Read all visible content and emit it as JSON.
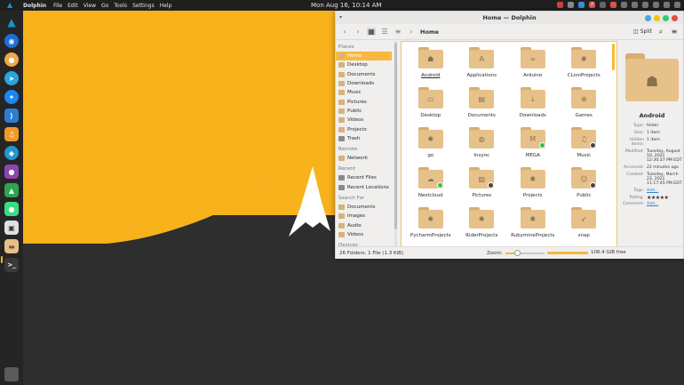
{
  "topbar": {
    "app_name": "Dolphin",
    "menu": [
      "File",
      "Edit",
      "View",
      "Go",
      "Tools",
      "Settings",
      "Help"
    ],
    "clock": "Mon Aug 16, 10:14 AM",
    "tray_badge": "2"
  },
  "dock": {
    "items": [
      "arch-logo",
      "browser-beta-icon",
      "contacts-icon",
      "telegram-icon",
      "messenger-icon",
      "vscode-icon",
      "office-icon",
      "flutter-icon",
      "github-icon",
      "charts-icon",
      "android-studio-icon",
      "store-icon",
      "files-icon",
      "terminal-icon"
    ]
  },
  "window": {
    "title": "Home — Dolphin",
    "breadcrumb": "Home",
    "split_label": "Split"
  },
  "sidebar": {
    "places_head": "Places",
    "places": [
      "Home",
      "Desktop",
      "Documents",
      "Downloads",
      "Music",
      "Pictures",
      "Public",
      "Videos",
      "Projects",
      "Trash"
    ],
    "remote_head": "Remote",
    "remote": [
      "Network"
    ],
    "recent_head": "Recent",
    "recent": [
      "Recent Files",
      "Recent Locations"
    ],
    "search_head": "Search For",
    "search": [
      "Documents",
      "Images",
      "Audio",
      "Videos"
    ],
    "devices_head": "Devices"
  },
  "files": [
    {
      "name": "Android",
      "emblem": "android-icon"
    },
    {
      "name": "Applications",
      "emblem": "applications-icon"
    },
    {
      "name": "Arduino",
      "emblem": "arduino-icon"
    },
    {
      "name": "CLionProjects",
      "emblem": "gear-icon"
    },
    {
      "name": "Desktop",
      "emblem": "desktop-icon"
    },
    {
      "name": "Documents",
      "emblem": "document-icon"
    },
    {
      "name": "Downloads",
      "emblem": "download-icon"
    },
    {
      "name": "Games",
      "emblem": "gamepad-icon"
    },
    {
      "name": "go",
      "emblem": "gear-icon"
    },
    {
      "name": "Insync",
      "emblem": "globe-icon"
    },
    {
      "name": "MEGA",
      "emblem": "mega-icon",
      "badge": "#3fb950"
    },
    {
      "name": "Music",
      "emblem": "music-icon",
      "badge": "#444444"
    },
    {
      "name": "Nextcloud",
      "emblem": "cloud-icon",
      "badge": "#3fb950"
    },
    {
      "name": "Pictures",
      "emblem": "image-icon",
      "badge": "#444444"
    },
    {
      "name": "Projects",
      "emblem": "gear-icon"
    },
    {
      "name": "Public",
      "emblem": "user-icon",
      "badge": "#444444"
    },
    {
      "name": "PycharmProjects",
      "emblem": "gear-icon"
    },
    {
      "name": "RiderProjects",
      "emblem": "gear-icon"
    },
    {
      "name": "RubymineProjects",
      "emblem": "gear-icon"
    },
    {
      "name": "snap",
      "emblem": "snap-icon"
    }
  ],
  "info": {
    "name": "Android",
    "rows": [
      {
        "k": "Type:",
        "v": "folder"
      },
      {
        "k": "Size:",
        "v": "1 item"
      },
      {
        "k": "Hidden items:",
        "v": "1 item"
      },
      {
        "k": "Modified:",
        "v": "Tuesday, August 10, 2021 12:30:37 PM EDT"
      },
      {
        "k": "Accessed:",
        "v": "22 minutes ago"
      },
      {
        "k": "Created:",
        "v": "Tuesday, March 23, 2021 11:17:45 PM EDT"
      }
    ],
    "tags_label": "Tags:",
    "tags_value": "Add...",
    "rating_label": "Rating:",
    "rating_stars": "★★★★★",
    "comment_label": "Comment:",
    "comment_value": "Add..."
  },
  "status": {
    "summary": "26 Folders, 1 File (1.3 KiB)",
    "zoom_label": "Zoom:",
    "free_space": "106.4 GiB free",
    "zoom_level": 0.3
  },
  "colors": {
    "accent": "#f7b93d",
    "wallpaper_yellow": "#f7b21c",
    "folder": "#e7c18a"
  }
}
